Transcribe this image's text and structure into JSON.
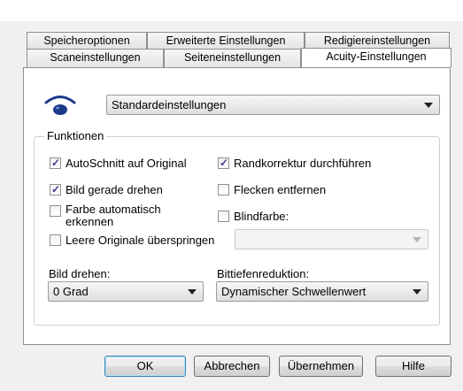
{
  "tabs": {
    "row_back": [
      "Speicheroptionen",
      "Erweiterte Einstellungen",
      "Redigiereinstellungen"
    ],
    "row_front": [
      "Scaneinstellungen",
      "Seiteneinstellungen",
      "Acuity-Einstellungen"
    ],
    "active": "Acuity-Einstellungen"
  },
  "profile": {
    "icon": "eye-icon",
    "selected": "Standardeinstellungen"
  },
  "functions": {
    "title": "Funktionen",
    "autocrop": {
      "label": "AutoSchnitt auf Original",
      "checked": true
    },
    "edge_fix": {
      "label": "Randkorrektur durchführen",
      "checked": true
    },
    "deskew": {
      "label": "Bild gerade drehen",
      "checked": true
    },
    "despeckle": {
      "label": "Flecken entfernen",
      "checked": false
    },
    "auto_color_line1": "Farbe automatisch",
    "auto_color_line2": "erkennen",
    "auto_color_checked": false,
    "dropout": {
      "label": "Blindfarbe:",
      "checked": false
    },
    "skip_blank": {
      "label": "Leere Originale überspringen",
      "checked": false
    },
    "blank_select_value": ""
  },
  "rotate": {
    "label": "Bild drehen:",
    "value": "0 Grad"
  },
  "bitdepth": {
    "label": "Bittiefenreduktion:",
    "value": "Dynamischer Schwellenwert"
  },
  "buttons": {
    "ok": "OK",
    "cancel": "Abbrechen",
    "apply": "Übernehmen",
    "help": "Hilfe"
  },
  "colors": {
    "dialog_bg": "#f0f0f0",
    "panel_bg": "#ffffff",
    "check_mark": "#3b3b8f",
    "eye": "#1b3b8a"
  }
}
